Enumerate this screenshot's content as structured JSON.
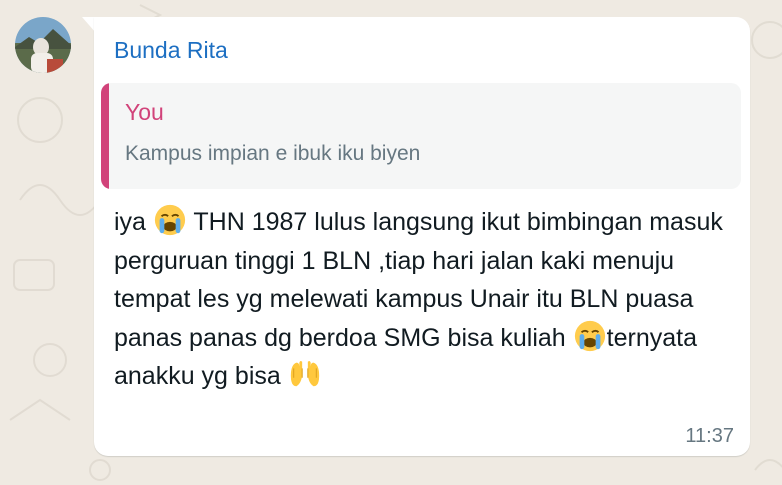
{
  "chat": {
    "sender_name": "Bunda Rita",
    "quoted": {
      "author": "You",
      "text": "Kampus impian e ibuk iku biyen"
    },
    "message_parts": {
      "p1": "iya ",
      "p2": " THN 1987 lulus langsung ikut bimbingan masuk perguruan tinggi 1 BLN ,tiap hari jalan kaki menuju tempat les yg melewati kampus Unair itu BLN puasa panas panas dg berdoa SMG bisa kuliah ",
      "p3": "ternyata anakku yg bisa "
    },
    "emojis": [
      "crying-face-emoji",
      "crying-face-emoji",
      "raised-hands-emoji"
    ],
    "time": "11:37"
  },
  "colors": {
    "background": "#efeae2",
    "bubble": "#ffffff",
    "sender": "#1d6fc2",
    "quote_accent": "#d1437a",
    "muted_text": "#667781",
    "text": "#111b21"
  }
}
